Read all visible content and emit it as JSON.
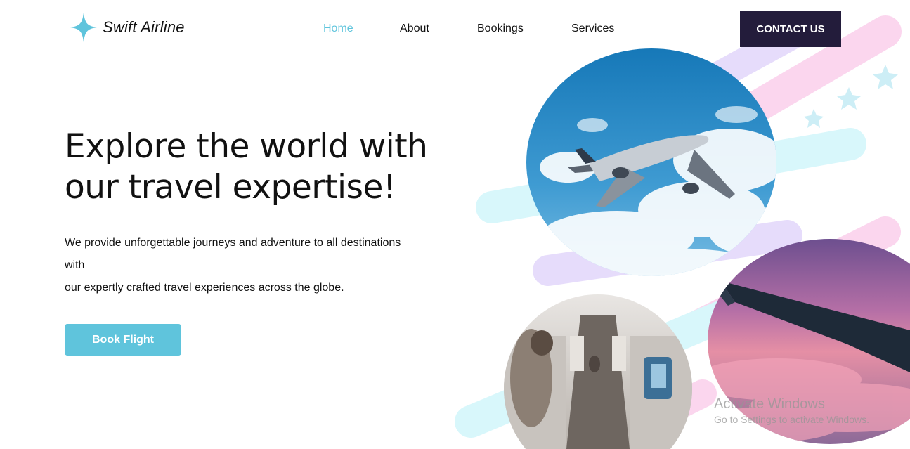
{
  "brand": {
    "name": "Swift Airline",
    "logo_icon": "four-point-star-icon",
    "accent": "#5fc4dc"
  },
  "nav": {
    "items": [
      {
        "label": "Home",
        "active": true
      },
      {
        "label": "About",
        "active": false
      },
      {
        "label": "Bookings",
        "active": false
      },
      {
        "label": "Services",
        "active": false
      }
    ],
    "contact_label": "CONTACT US",
    "contact_color": "#231c3b"
  },
  "hero": {
    "headline_line1": "Explore the world with",
    "headline_line2": "our travel expertise!",
    "description_lines": [
      "We provide unforgettable journeys and adventure to all destinations",
      "with",
      "our expertly crafted travel experiences across the globe."
    ],
    "cta_label": "Book Flight"
  },
  "images": {
    "top": "airplane-in-blue-sky",
    "bottom_left": "airplane-cabin-aisle",
    "bottom_right": "wing-over-pink-clouds"
  },
  "watermark": {
    "line1": "Activate Windows",
    "line2": "Go to Settings to activate Windows."
  }
}
